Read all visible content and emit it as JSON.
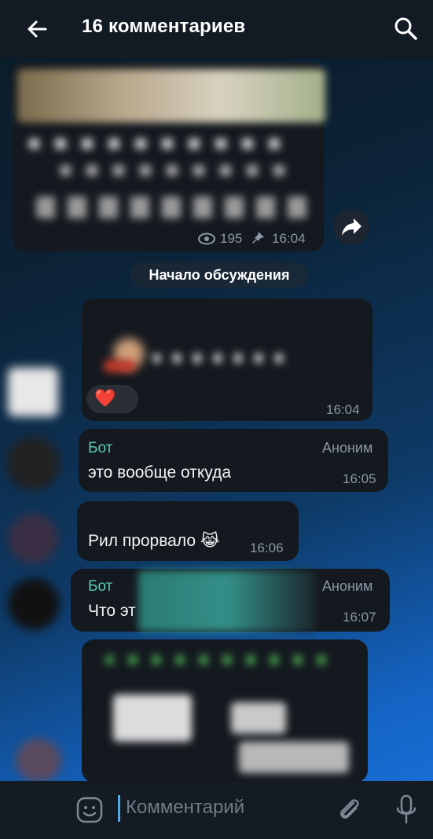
{
  "header": {
    "title": "16 комментариев"
  },
  "post": {
    "views": "195",
    "time": "16:04"
  },
  "divider_label": "Начало обсуждения",
  "messages": [
    {
      "time": "16:04",
      "reaction": "❤️"
    },
    {
      "name": "Бот",
      "tag": "Аноним",
      "text": "это вообще откуда",
      "time": "16:05"
    },
    {
      "text": "Рил прорвало 😹",
      "time": "16:06"
    },
    {
      "name": "Бот",
      "tag": "Аноним",
      "text": "Что эт",
      "time": "16:07"
    }
  ],
  "composer": {
    "placeholder": "Комментарий"
  },
  "colors": {
    "accent_name": "#59c9b8",
    "header_bg": "#121b24",
    "bubble_bg": "#14191f"
  },
  "icons": [
    "back-arrow-icon",
    "search-icon",
    "eye-icon",
    "pin-icon",
    "share-icon",
    "emoji-icon",
    "attach-icon",
    "mic-icon"
  ]
}
